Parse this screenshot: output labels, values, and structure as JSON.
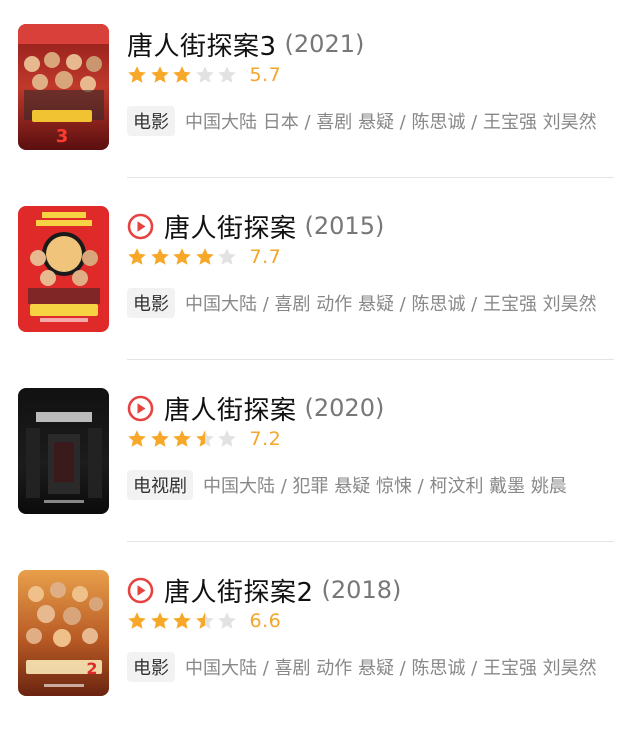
{
  "results": [
    {
      "title": "唐人街探案3",
      "year": "(2021)",
      "has_play": false,
      "rating_stars": 3,
      "score": "5.7",
      "type": "电影",
      "meta": "中国大陆 日本 / 喜剧 悬疑 / 陈思诚 / 王宝强 刘昊然"
    },
    {
      "title": "唐人街探案",
      "year": "(2015)",
      "has_play": true,
      "rating_stars": 4,
      "score": "7.7",
      "type": "电影",
      "meta": "中国大陆 / 喜剧 动作 悬疑 / 陈思诚 / 王宝强 刘昊然"
    },
    {
      "title": "唐人街探案",
      "year": "(2020)",
      "has_play": true,
      "rating_stars": 3.5,
      "score": "7.2",
      "type": "电视剧",
      "meta": "中国大陆 / 犯罪 悬疑 惊悚 / 柯汶利 戴墨 姚晨"
    },
    {
      "title": "唐人街探案2",
      "year": "(2018)",
      "has_play": true,
      "rating_stars": 3.5,
      "score": "6.6",
      "type": "电影",
      "meta": "中国大陆 / 喜剧 动作 悬疑 / 陈思诚 / 王宝强 刘昊然"
    }
  ],
  "colors": {
    "star_active": "#f7a828",
    "star_inactive": "#e2e2e2",
    "play_icon": "#e64340",
    "score": "#f4a52a"
  }
}
